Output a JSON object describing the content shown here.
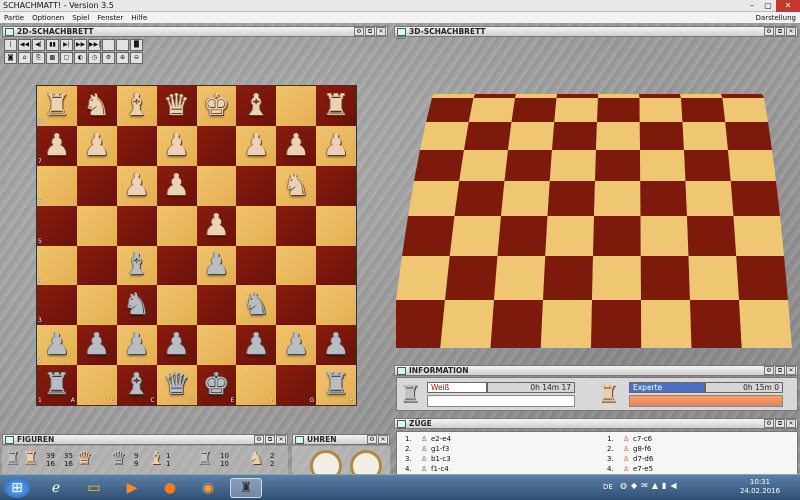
{
  "window": {
    "title": "SCHACHMATT! - Version 3.5",
    "controls": [
      "–",
      "▢",
      "✕"
    ]
  },
  "menu": {
    "items": [
      "Partie",
      "Optionen",
      "Spiel",
      "Fenster",
      "Hilfe"
    ],
    "right": "Darstellung"
  },
  "panels": {
    "board2d": "2D-SCHACHBRETT",
    "board3d": "3D-SCHACHBRETT",
    "info": "INFORMATION",
    "moves": "ZÜGE",
    "pieces": "FIGUREN",
    "clocks": "UHREN"
  },
  "toolbar1": [
    "|◀◀",
    "◀◀",
    "◀|",
    "▮▮",
    "▶|",
    "▶▶",
    "▶▶|",
    "",
    "",
    "▐▌"
  ],
  "toolbar2": [
    "◙",
    "⌂",
    "⎘",
    "▩",
    "▢",
    "◐",
    "◷",
    "⚙",
    "⊕",
    "⊖"
  ],
  "board": {
    "ranks": [
      "8",
      "7",
      "6",
      "5",
      "4",
      "3",
      "2",
      "1"
    ],
    "files": [
      "A",
      "B",
      "C",
      "D",
      "E",
      "F",
      "G",
      "H"
    ],
    "rows": [
      [
        "r",
        "n",
        "b",
        "q",
        "k",
        "b",
        "",
        "r"
      ],
      [
        "p",
        "p",
        "",
        "p",
        "",
        "p",
        "p",
        "p"
      ],
      [
        "",
        "",
        "p",
        "p",
        "",
        "",
        "n",
        ""
      ],
      [
        "",
        "",
        "",
        "",
        "p",
        "",
        "",
        ""
      ],
      [
        "",
        "",
        "B",
        "",
        "P",
        "",
        "",
        ""
      ],
      [
        "",
        "",
        "N",
        "",
        "",
        "N",
        "",
        ""
      ],
      [
        "P",
        "P",
        "P",
        "P",
        "",
        "P",
        "P",
        "P"
      ],
      [
        "R",
        "",
        "B",
        "Q",
        "K",
        "",
        "",
        "R"
      ]
    ],
    "glyphs": {
      "K": "♚",
      "Q": "♛",
      "R": "♜",
      "B": "♝",
      "N": "♞",
      "P": "♟",
      "k": "♚",
      "q": "♛",
      "r": "♜",
      "b": "♝",
      "n": "♞",
      "p": "♟"
    }
  },
  "info": {
    "white": {
      "name": "Weiß",
      "time": "0h 14m 17"
    },
    "black": {
      "name": "Experte",
      "time": "0h 15m 0"
    }
  },
  "moves": {
    "white": [
      {
        "n": "1.",
        "m": "e2-e4"
      },
      {
        "n": "2.",
        "m": "g1-f3"
      },
      {
        "n": "3.",
        "m": "b1-c3"
      },
      {
        "n": "4.",
        "m": "f1-c4"
      }
    ],
    "black": [
      {
        "n": "1.",
        "m": "c7-c6"
      },
      {
        "n": "2.",
        "m": "g8-f6"
      },
      {
        "n": "3.",
        "m": "d7-d6"
      },
      {
        "n": "4.",
        "m": "e7-e5"
      }
    ]
  },
  "figures": {
    "counts": [
      [
        "39",
        "16"
      ],
      [
        "35",
        "16"
      ]
    ],
    "row2": [
      [
        "9",
        "9"
      ],
      [
        "1",
        "1"
      ],
      [
        "10",
        "10"
      ],
      [
        "2",
        "2"
      ]
    ]
  },
  "taskbar": {
    "lang": "DE",
    "time": "10:31",
    "date": "24.02.2016",
    "start_icon": "windows-start-icon"
  }
}
